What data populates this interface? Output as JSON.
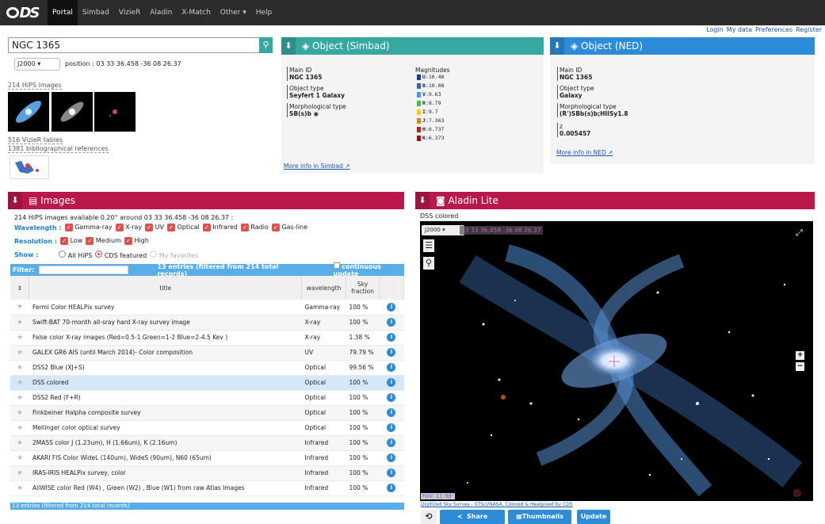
{
  "nav": {
    "items": [
      "Portal",
      "Simbad",
      "VizieR",
      "Aladin",
      "X-Match",
      "Other",
      "Help"
    ],
    "user_links": [
      "Login",
      "My data",
      "Preferences",
      "Register"
    ]
  },
  "search": {
    "value": "NGC 1365"
  },
  "frame": {
    "value": "J2000"
  },
  "position_text": "position : 03 33 36.458 -36 08 26.37",
  "left_links": {
    "hips": "214 HiPS images",
    "vizier": "516 VizieR tables",
    "biblio": "1381 bibliographical references"
  },
  "simbad": {
    "title": "Object (Simbad)",
    "main_id_label": "Main ID",
    "main_id": "NGC 1365",
    "type_label": "Object type",
    "type": "Seyfert 1 Galaxy",
    "morph_label": "Morphological type",
    "morph": "SB(s)b",
    "mag_label": "Magnitudes",
    "magnitudes": [
      {
        "band": "U",
        "value": "10.48",
        "color": "#1a3aa0"
      },
      {
        "band": "B",
        "value": "10.08",
        "color": "#3060c0"
      },
      {
        "band": "V",
        "value": "9.63",
        "color": "#3aa0e0"
      },
      {
        "band": "R",
        "value": "8.79",
        "color": "#40c040"
      },
      {
        "band": "I",
        "value": "9.7",
        "color": "#f0d000"
      },
      {
        "band": "J",
        "value": "7.363",
        "color": "#e08020"
      },
      {
        "band": "H",
        "value": "6.737",
        "color": "#c02020"
      },
      {
        "band": "K",
        "value": "6.373",
        "color": "#a01010"
      }
    ],
    "more": "More info in Simbad"
  },
  "ned": {
    "title": "Object (NED)",
    "main_id_label": "Main ID",
    "main_id": "NGC 1365",
    "type_label": "Object type",
    "type": "Galaxy",
    "morph_label": "Morphological type",
    "morph": "(R')SBb(s)b;HIISy1.8",
    "z_label": "z",
    "z": "0.005457",
    "more": "More info in NED"
  },
  "images": {
    "title": "Images",
    "summary": "214 HiPS images available 0.20° around 03 33 36.458 -36 08 26.37 :",
    "wavelength_label": "Wavelength :",
    "wavelengths": [
      "Gamma-ray",
      "X-ray",
      "UV",
      "Optical",
      "Infrared",
      "Radio",
      "Gas-line"
    ],
    "resolution_label": "Resolution :",
    "resolutions": [
      "Low",
      "Medium",
      "High"
    ],
    "show_label": "Show :",
    "show_opts": [
      "All HiPS",
      "CDS featured",
      "My favorites"
    ],
    "filter_label": "Filter:",
    "filter_count": "13 entries (filtered from 214 total records)",
    "continuous": "continuous update",
    "col_title": "title",
    "col_wavelength": "wavelength",
    "col_sky": "Sky fraction",
    "rows": [
      {
        "title": "Fermi Color HEALPix survey",
        "wl": "Gamma-ray",
        "sky": "100 %"
      },
      {
        "title": "Swift-BAT 70-month all-sray hard X-ray survey image",
        "wl": "X-ray",
        "sky": "100 %"
      },
      {
        "title": "False color X-ray images (Red=0.5-1 Green=1-2 Blue=2-4.5 Kev )",
        "wl": "X-ray",
        "sky": "1.38 %"
      },
      {
        "title": "GALEX GR6 AIS (until March 2014)- Color composition",
        "wl": "UV",
        "sky": "79.79 %"
      },
      {
        "title": "DSS2 Blue (XJ+S)",
        "wl": "Optical",
        "sky": "99.56 %"
      },
      {
        "title": "DSS colored",
        "wl": "Optical",
        "sky": "100 %"
      },
      {
        "title": "DSS2 Red (F+R)",
        "wl": "Optical",
        "sky": "100 %"
      },
      {
        "title": "Finkbeiner Halpha composite survey",
        "wl": "Optical",
        "sky": "100 %"
      },
      {
        "title": "Mellinger color optical survey",
        "wl": "Optical",
        "sky": "100 %"
      },
      {
        "title": "2MASS color J (1.23um), H (1.66um), K (2.16um)",
        "wl": "Infrared",
        "sky": "100 %"
      },
      {
        "title": "AKARI FIS Color WideL (140um), WideS (90um), N60 (65um)",
        "wl": "Infrared",
        "sky": "100 %"
      },
      {
        "title": "IRAS-IRIS HEALPix survey, color",
        "wl": "Infrared",
        "sky": "100 %"
      },
      {
        "title": "AllWISE color Red (W4) , Green (W2) , Blue (W1) from raw Atlas Images",
        "wl": "Infrared",
        "sky": "100 %"
      }
    ],
    "footer": "13 entries (filtered from 214 total records)"
  },
  "aladin": {
    "title": "Aladin Lite",
    "survey": "DSS colored",
    "frame": "J2000",
    "position": "03 33 36.458 -36 08 26.37",
    "fov": "FoV: 11.98'",
    "credit": "Digitized Sky Survey - STScI/NASA. Colored & Healpixed by CDS",
    "share": "Share",
    "thumbnails": "Thumbnails",
    "update": "Update"
  }
}
